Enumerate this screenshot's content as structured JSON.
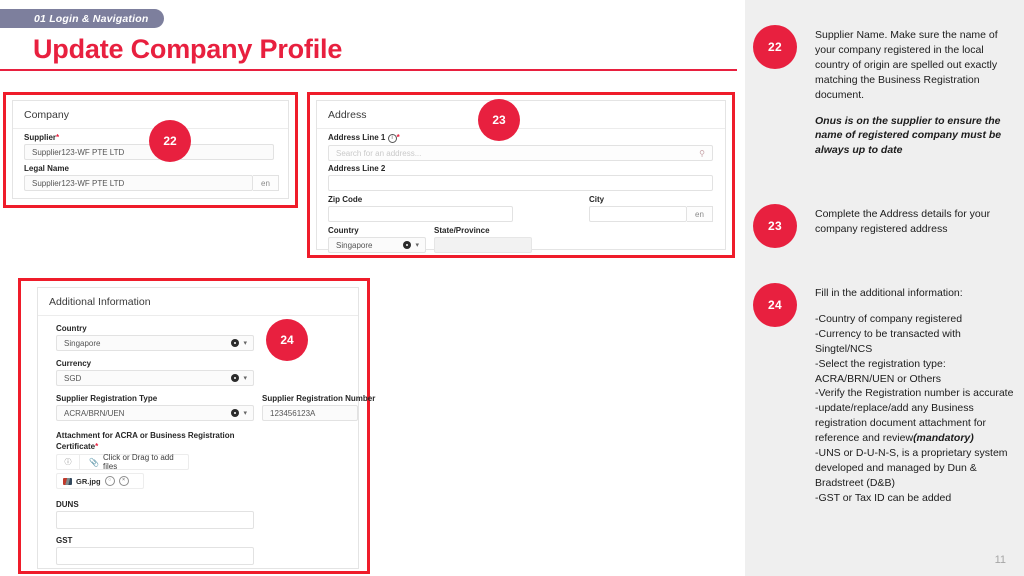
{
  "header": {
    "tab_label": "01 Login & Navigation",
    "title": "Update Company Profile"
  },
  "page_number": "11",
  "colors": {
    "accent_red": "#e8203f",
    "callout_border": "#ef1c2a",
    "tab_pill": "#7d7f9d",
    "rail_bg": "#efefef"
  },
  "company_card": {
    "heading": "Company",
    "supplier": {
      "label": "Supplier",
      "required": "*",
      "value": "Supplier123-WF PTE LTD"
    },
    "legal_name": {
      "label": "Legal Name",
      "value": "Supplier123-WF PTE LTD",
      "lang_suffix": "en"
    },
    "badge": "22"
  },
  "address_card": {
    "heading": "Address",
    "address_line_1": {
      "label": "Address Line 1",
      "info_icon": "info-icon",
      "required": "*",
      "placeholder": "Search for an address...",
      "value": "",
      "action_icon": "search-icon"
    },
    "address_line_2": {
      "label": "Address Line 2",
      "value": ""
    },
    "zip_code": {
      "label": "Zip Code",
      "value": ""
    },
    "city": {
      "label": "City",
      "value": "",
      "lang_suffix": "en"
    },
    "country": {
      "label": "Country",
      "value": "Singapore",
      "clear_icon": "clear-icon",
      "caret_icon": "chevron-down-icon"
    },
    "state_province": {
      "label": "State/Province",
      "value": ""
    },
    "badge": "23"
  },
  "additional_card": {
    "heading": "Additional Information",
    "country": {
      "label": "Country",
      "value": "Singapore"
    },
    "currency": {
      "label": "Currency",
      "value": "SGD"
    },
    "registration_type": {
      "label": "Supplier Registration Type",
      "value": "ACRA/BRN/UEN"
    },
    "registration_number": {
      "label": "Supplier Registration Number",
      "value": "123456123A"
    },
    "attachment": {
      "label_line1": "Attachment for ACRA or Business Registration",
      "label_line2": "Certificate",
      "required": "*",
      "info_icon": "info-icon",
      "dropzone_text": "Click or Drag to add files",
      "clip_icon": "paperclip-icon",
      "file_name": "GR.jpg",
      "file_thumb_icon": "image-thumbnail-icon",
      "file_preview_icon": "eye-icon",
      "file_remove_icon": "remove-icon"
    },
    "duns": {
      "label": "DUNS",
      "value": ""
    },
    "gst": {
      "label": "GST",
      "value": ""
    },
    "badge": "24"
  },
  "notes": [
    {
      "badge": "22",
      "paragraph_1": "Supplier Name. Make sure the name of your company registered in the local country of origin are spelled out exactly matching the Business Registration document.",
      "paragraph_2": "Onus is on the supplier to ensure the name of registered company must be always up to date"
    },
    {
      "badge": "23",
      "paragraph_1": "Complete the Address details for your company registered address"
    },
    {
      "badge": "24",
      "intro": "Fill in the additional information:",
      "bullets_before": "-Country of company registered\n-Currency to be transacted with Singtel/NCS\n-Select the registration type: ACRA/BRN/UEN or Others\n-Verify the Registration number is accurate\n-update/replace/add any Business registration document attachment for reference and review",
      "emphasis": "(mandatory)",
      "bullets_after": "-UNS or D-U-N-S, is a proprietary system developed and managed by Dun & Bradstreet (D&B)\n-GST or Tax ID can be added"
    }
  ]
}
